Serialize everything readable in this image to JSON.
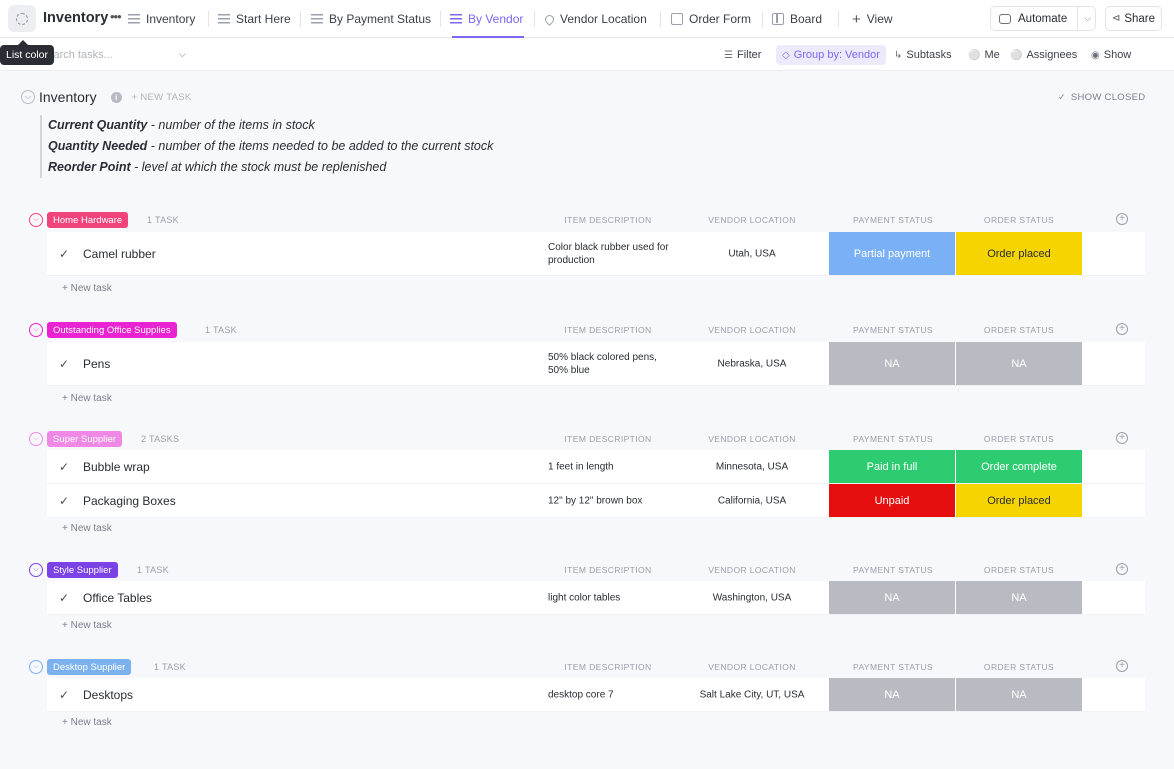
{
  "topbar": {
    "title": "Inventory",
    "more": "•••",
    "tabs": [
      {
        "label": "Inventory",
        "icon": "list-icon"
      },
      {
        "label": "Start Here",
        "icon": "list-icon"
      },
      {
        "label": "By Payment Status",
        "icon": "list-icon"
      },
      {
        "label": "By Vendor",
        "icon": "list-icon",
        "active": true
      },
      {
        "label": "Vendor Location",
        "icon": "map-pin-icon"
      },
      {
        "label": "Order Form",
        "icon": "form-icon"
      },
      {
        "label": "Board",
        "icon": "board-icon"
      }
    ],
    "add_view": "View",
    "automate": "Automate",
    "share": "Share"
  },
  "tooltip": "List color",
  "toolbar": {
    "search_placeholder": "Search tasks...",
    "filter": "Filter",
    "group_by": "Group by: Vendor",
    "subtasks": "Subtasks",
    "me": "Me",
    "assignees": "Assignees",
    "show": "Show"
  },
  "list": {
    "name": "Inventory",
    "new_task": "+ NEW TASK",
    "show_closed": "SHOW CLOSED",
    "description": [
      {
        "term": "Current Quantity",
        "text": " - number of the items in stock"
      },
      {
        "term": "Quantity Needed",
        "text": " - number of the items needed to be added to the current stock"
      },
      {
        "term": "Reorder Point",
        "text": " - level at which the stock must be replenished"
      }
    ]
  },
  "columns": {
    "item_description": "ITEM DESCRIPTION",
    "vendor_location": "VENDOR LOCATION",
    "payment_status": "PAYMENT STATUS",
    "order_status": "ORDER STATUS"
  },
  "new_task_row": "+ New task",
  "groups": [
    {
      "name": "Home Hardware",
      "color": "#f0447a",
      "count": "1 TASK",
      "tasks": [
        {
          "name": "Camel rubber",
          "description": "Color black rubber used for production",
          "location": "Utah, USA",
          "payment": "Partial payment",
          "payment_color": "#7ab0f5",
          "payment_text_color": "#ffffff",
          "order": "Order placed",
          "order_color": "#f5d400",
          "order_text_color": "#292d34"
        }
      ]
    },
    {
      "name": "Outstanding Office Supplies",
      "color": "#e922d2",
      "count": "1 TASK",
      "tasks": [
        {
          "name": "Pens",
          "description": "50% black colored pens, 50% blue",
          "location": "Nebraska, USA",
          "payment": "NA",
          "payment_color": "#b8bcc2",
          "payment_text_color": "#ffffff",
          "order": "NA",
          "order_color": "#b8bcc2",
          "order_text_color": "#ffffff"
        }
      ]
    },
    {
      "name": "Super Supplier",
      "color": "#f089e6",
      "count": "2 TASKS",
      "tasks": [
        {
          "name": "Bubble wrap",
          "description": "1 feet in length",
          "location": "Minnesota, USA",
          "payment": "Paid in full",
          "payment_color": "#2ecc71",
          "payment_text_color": "#ffffff",
          "order": "Order complete",
          "order_color": "#2ecc71",
          "order_text_color": "#ffffff"
        },
        {
          "name": "Packaging Boxes",
          "description": "12\" by 12\" brown box",
          "location": "California, USA",
          "payment": "Unpaid",
          "payment_color": "#e60e0e",
          "payment_text_color": "#ffffff",
          "order": "Order placed",
          "order_color": "#f5d400",
          "order_text_color": "#292d34"
        }
      ]
    },
    {
      "name": "Style Supplier",
      "color": "#7b42e6",
      "count": "1 TASK",
      "tasks": [
        {
          "name": "Office Tables",
          "description": "light color tables",
          "location": "Washington, USA",
          "payment": "NA",
          "payment_color": "#b8bcc2",
          "payment_text_color": "#ffffff",
          "order": "NA",
          "order_color": "#b8bcc2",
          "order_text_color": "#ffffff"
        }
      ]
    },
    {
      "name": "Desktop Supplier",
      "color": "#7cb1f0",
      "count": "1 TASK",
      "tasks": [
        {
          "name": "Desktops",
          "description": "desktop core 7",
          "location": "Salt Lake City, UT, USA",
          "payment": "NA",
          "payment_color": "#b8bcc2",
          "payment_text_color": "#ffffff",
          "order": "NA",
          "order_color": "#b8bcc2",
          "order_text_color": "#ffffff"
        }
      ]
    }
  ]
}
